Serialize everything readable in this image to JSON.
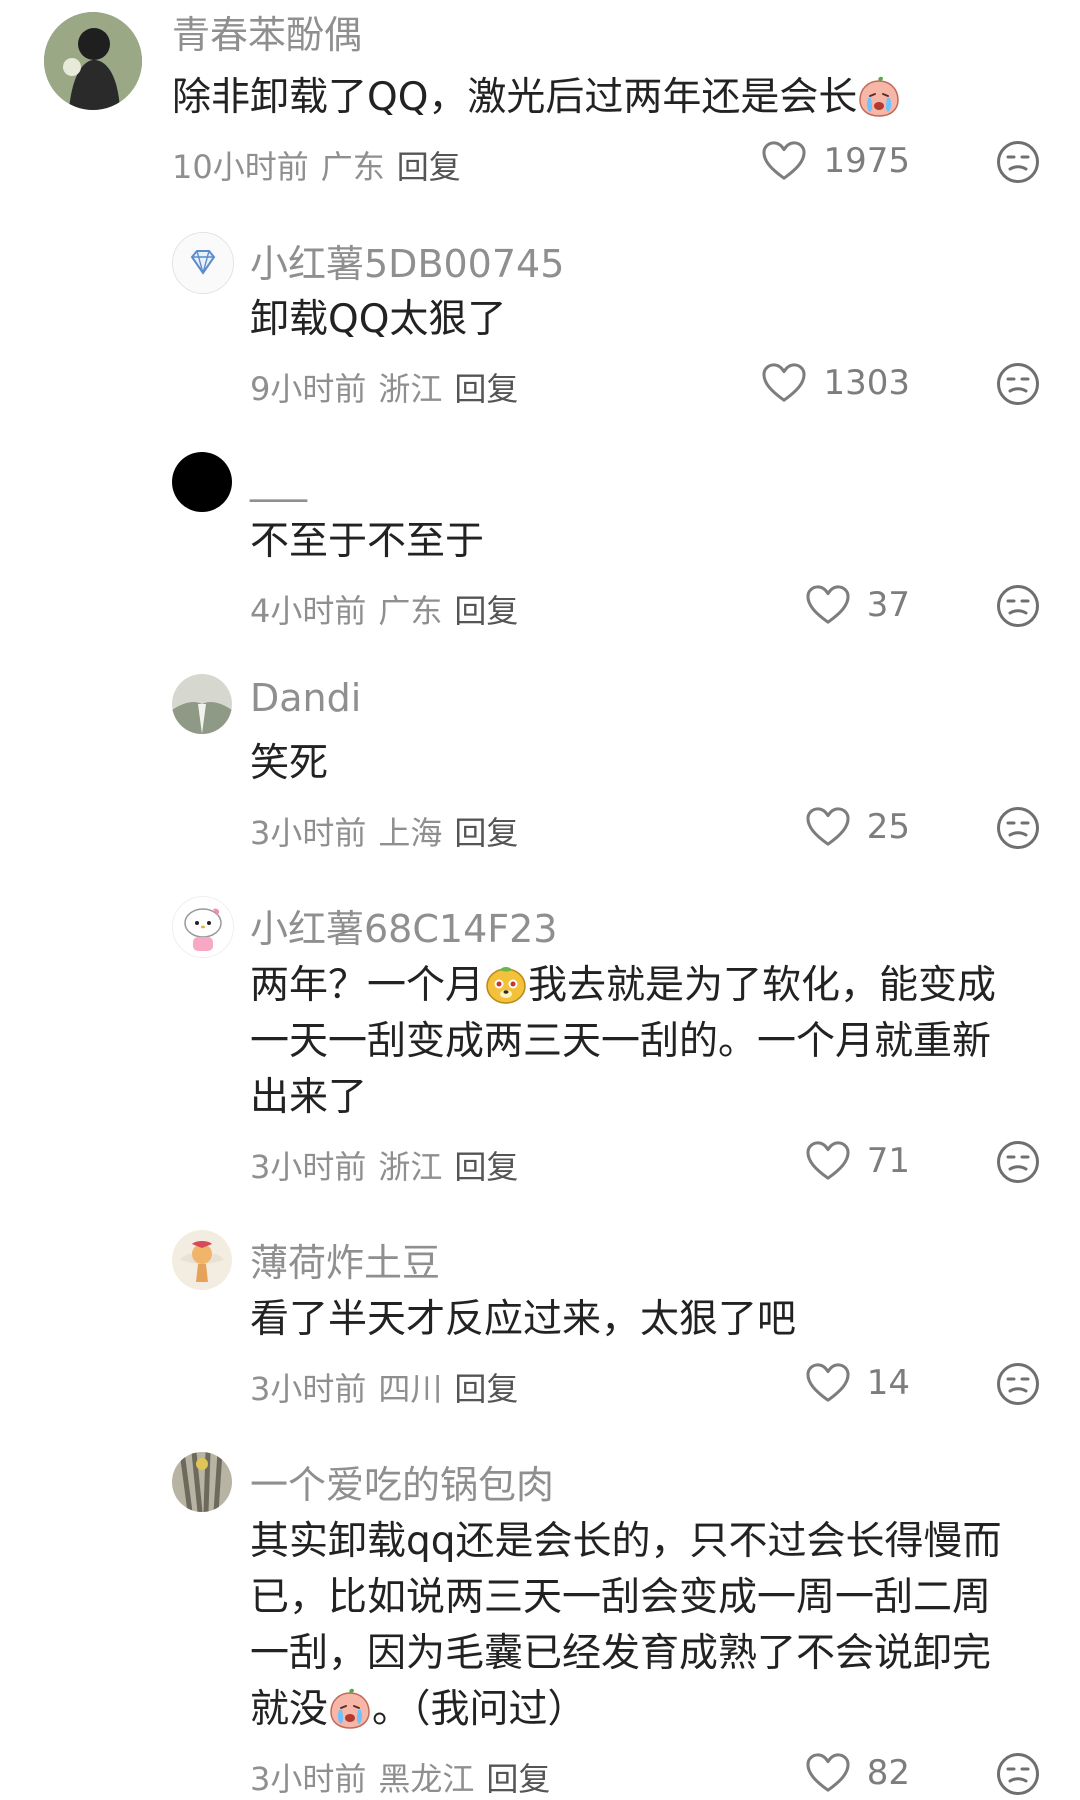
{
  "comments": [
    {
      "username": "青春苯酚偶",
      "text_before": "除非卸载了QQ，激光后过两年还是会长",
      "text_after": "",
      "time": "10小时前",
      "location": "广东",
      "reply": "回复",
      "likes": "1975"
    },
    {
      "username": "小红薯5DB00745",
      "text": "卸载QQ太狠了",
      "time": "9小时前",
      "location": "浙江",
      "reply": "回复",
      "likes": "1303"
    },
    {
      "username": "___",
      "text": "不至于不至于",
      "time": "4小时前",
      "location": "广东",
      "reply": "回复",
      "likes": "37"
    },
    {
      "username": "Dandi",
      "text": "笑死",
      "time": "3小时前",
      "location": "上海",
      "reply": "回复",
      "likes": "25"
    },
    {
      "username": "小红薯68C14F23",
      "text_before": "两年？一个月",
      "text_after": "我去就是为了软化，能变成一天一刮变成两三天一刮的。一个月就重新出来了",
      "time": "3小时前",
      "location": "浙江",
      "reply": "回复",
      "likes": "71"
    },
    {
      "username": "薄荷炸土豆",
      "text": "看了半天才反应过来，太狠了吧",
      "time": "3小时前",
      "location": "四川",
      "reply": "回复",
      "likes": "14"
    },
    {
      "username": "一个爱吃的锅包肉",
      "text_before": "其实卸载qq还是会长的，只不过会长得慢而已，比如说两三天一刮会变成一周一刮二周一刮，因为毛囊已经发育成熟了不会说卸完就没",
      "text_after": "。（我问过）",
      "time": "3小时前",
      "location": "黑龙江",
      "reply": "回复",
      "likes": "82"
    }
  ],
  "icons": {
    "like": "heart-outline-icon",
    "dislike": "unimpressed-face-icon",
    "crying_emoji": "crying-face-emoji",
    "doge_emoji": "doge-emoji"
  },
  "colors": {
    "text": "#222222",
    "secondary": "#8f8f8f",
    "icon": "#7d7d7d"
  }
}
